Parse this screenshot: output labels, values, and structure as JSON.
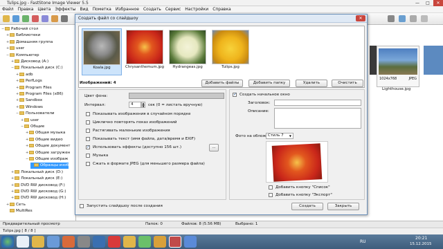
{
  "app": {
    "title": "Tulips.jpg  -  FastStone Image Viewer 5.5"
  },
  "window_controls": {
    "minimize": "—",
    "maximize": "□",
    "close": "✕"
  },
  "menu": [
    "Файл",
    "Правка",
    "Цвета",
    "Эффекты",
    "Вид",
    "Пометка",
    "Избранное",
    "Создать",
    "Сервис",
    "Настройки",
    "Справка"
  ],
  "tree": {
    "items": [
      {
        "label": "Рабочий стол",
        "level": 0,
        "expander": "−"
      },
      {
        "label": "Библиотеки",
        "level": 1,
        "expander": "+"
      },
      {
        "label": "Домашняя группа",
        "level": 1,
        "expander": "+"
      },
      {
        "label": "user",
        "level": 1,
        "expander": "+"
      },
      {
        "label": "Компьютер",
        "level": 1,
        "expander": "−"
      },
      {
        "label": "Дисковод (A:)",
        "level": 2,
        "expander": "+"
      },
      {
        "label": "Локальный диск (C:)",
        "level": 2,
        "expander": "−"
      },
      {
        "label": "adb",
        "level": 3,
        "expander": "+"
      },
      {
        "label": "PerfLogs",
        "level": 3,
        "expander": "+"
      },
      {
        "label": "Program Files",
        "level": 3,
        "expander": "+"
      },
      {
        "label": "Program Files (x86)",
        "level": 3,
        "expander": "+"
      },
      {
        "label": "Sandbox",
        "level": 3,
        "expander": "+"
      },
      {
        "label": "Windows",
        "level": 3,
        "expander": "+"
      },
      {
        "label": "Пользователи",
        "level": 3,
        "expander": "−"
      },
      {
        "label": "user",
        "level": 4,
        "expander": "+"
      },
      {
        "label": "Общие",
        "level": 4,
        "expander": "−"
      },
      {
        "label": "Общая музыка",
        "level": 5,
        "expander": "+"
      },
      {
        "label": "Общие видео",
        "level": 5,
        "expander": "+"
      },
      {
        "label": "Общие документ",
        "level": 5,
        "expander": "+"
      },
      {
        "label": "Общие загружен",
        "level": 5,
        "expander": "+"
      },
      {
        "label": "Общие изображ",
        "level": 5,
        "expander": "−"
      },
      {
        "label": "Образцы изоб",
        "level": 6,
        "expander": "",
        "selected": true
      },
      {
        "label": "Локальный диск (D:)",
        "level": 2,
        "expander": "+"
      },
      {
        "label": "Локальный диск (E:)",
        "level": 2,
        "expander": "+"
      },
      {
        "label": "DVD RW дисковод (F:)",
        "level": 2,
        "expander": "+"
      },
      {
        "label": "DVD RW дисковод (G:)",
        "level": 2,
        "expander": "+"
      },
      {
        "label": "DVD RW дисковод (H:)",
        "level": 2,
        "expander": "+"
      },
      {
        "label": "Сеть",
        "level": 1,
        "expander": "+"
      },
      {
        "label": "MultiRes",
        "level": 1,
        "expander": ""
      }
    ]
  },
  "right_pane": {
    "thumbs": [
      {
        "caption": "1024x768",
        "format": "JPEG",
        "name": "Lighthouse.jpg"
      }
    ]
  },
  "dialog": {
    "title": "Создать файл со слайдшоу",
    "close": "✕",
    "thumbnails": [
      {
        "label": "Koala.jpg",
        "icon": "koala-photo"
      },
      {
        "label": "Chrysanthemum.jpg",
        "icon": "chrysanthemum-photo"
      },
      {
        "label": "Hydrangeas.jpg",
        "icon": "hydrangeas-photo"
      },
      {
        "label": "Tulips.jpg",
        "icon": "tulips-photo"
      }
    ],
    "image_count": "Изображений: 4",
    "buttons": {
      "add_files": "Добавить файлы",
      "add_folder": "Добавить папку",
      "remove": "Удалить",
      "clear": "Очистить",
      "ellipsis": "...",
      "create": "Создать",
      "close": "Закрыть"
    },
    "left": {
      "bg_color_label": "Цвет фона:",
      "interval_label": "Интервал:",
      "interval_value": "4",
      "interval_unit": "сек  (0 = листать вручную)",
      "options": [
        {
          "label": "Показывать изображения в случайном порядке",
          "checked": false
        },
        {
          "label": "Циклично повторять показ изображений",
          "checked": false
        },
        {
          "label": "Растягивать маленькие изображения",
          "checked": false
        },
        {
          "label": "Показывать текст (имя файла, дата/время и EXIF)",
          "checked": false
        },
        {
          "label": "Использовать эффекты (доступно 156 шт.)",
          "checked": true
        },
        {
          "label": "Музыка",
          "checked": false
        },
        {
          "label": "Сжать в формате JPEG (для меньшего размера файла)",
          "checked": false
        }
      ],
      "autostart_label": "Запустить слайдшоу после создания"
    },
    "right": {
      "start_window_label": "Создать начальное окно",
      "header_label": "Заголовок:",
      "description_label": "Описание:",
      "cover_label": "Фото на обложку:",
      "cover_select": "Стиль 7",
      "list_button_label": "Добавить кнопку \"Список\"",
      "export_button_label": "Добавить кнопку \"Экспорт\""
    }
  },
  "status": {
    "preview": "Предварительный просмотр",
    "folders": "Папок: 0",
    "files": "Файлов: 8 (5.56 MB)",
    "selected": "Выбрано: 1",
    "file_info": "Tulips.jpg [ 8 / 8 ]"
  },
  "taskbar": {
    "lang": "RU",
    "time": "20:21",
    "date": "15.12.2015"
  },
  "colors": {
    "selection": "#3399ff",
    "dialog_border": "#6a8fb8",
    "taskbar": "#3e5d7c"
  }
}
